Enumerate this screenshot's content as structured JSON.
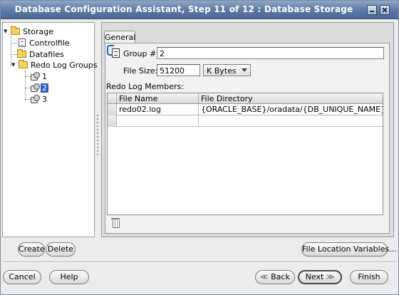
{
  "window": {
    "title": "Database Configuration Assistant, Step 11 of 12 : Database Storage"
  },
  "tree": {
    "root": "Storage",
    "controlfile": "Controlfile",
    "datafiles": "Datafiles",
    "redo_log_groups": "Redo Log Groups",
    "groups": [
      "1",
      "2",
      "3"
    ],
    "selected_group": "2"
  },
  "tab": {
    "label": "General"
  },
  "form": {
    "group_label": "Group #:",
    "group_value": "2",
    "file_size_label": "File Size:",
    "file_size_value": "51200",
    "unit_selected": "K Bytes",
    "members_label": "Redo Log Members:"
  },
  "table": {
    "headers": [
      "File Name",
      "File Directory"
    ],
    "rows": [
      {
        "file_name": "redo02.log",
        "file_directory": "{ORACLE_BASE}/oradata/{DB_UNIQUE_NAME}/"
      },
      {
        "file_name": "",
        "file_directory": ""
      }
    ]
  },
  "buttons": {
    "create": "Create",
    "delete": "Delete",
    "file_location_variables": "File Location Variables...",
    "cancel": "Cancel",
    "help": "Help",
    "back": "Back",
    "next": "Next",
    "finish": "Finish"
  }
}
